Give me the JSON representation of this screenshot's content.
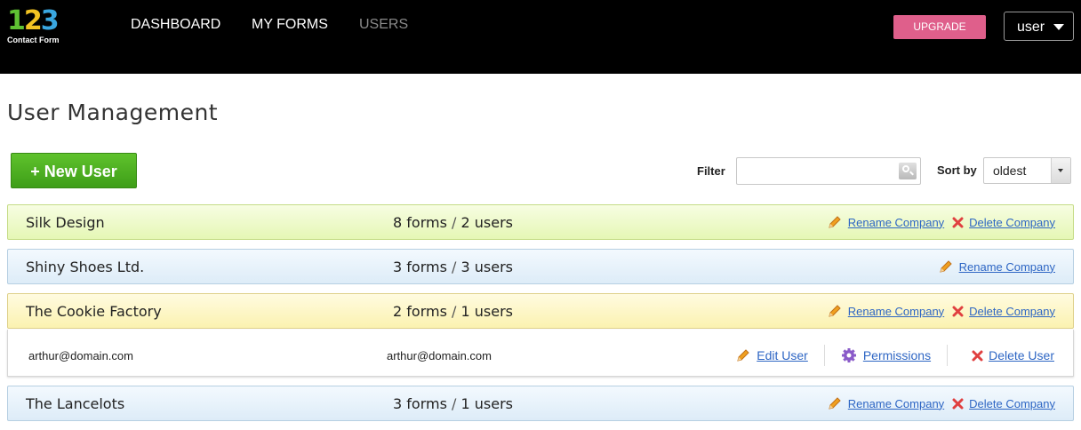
{
  "header": {
    "logo_digits": [
      "1",
      "2",
      "3"
    ],
    "logo_text": "Contact Form",
    "nav": [
      "DASHBOARD",
      "MY FORMS",
      "USERS"
    ],
    "upgrade_label": "UPGRADE",
    "user_menu_label": "user"
  },
  "page": {
    "title": "User Management",
    "new_user_label": "+ New User",
    "filter_label": "Filter",
    "filter_value": "",
    "sort_label": "Sort by",
    "sort_value": "oldest"
  },
  "companies": [
    {
      "name": "Silk Design",
      "forms": "8 forms",
      "users": "2 users",
      "rename_label": "Rename Company",
      "delete_label": "Delete Company"
    },
    {
      "name": "Shiny Shoes Ltd.",
      "forms": "3 forms",
      "users": "3 users",
      "rename_label": "Rename Company"
    },
    {
      "name": "The Cookie Factory",
      "forms": "2 forms",
      "users": "1 users",
      "rename_label": "Rename Company",
      "delete_label": "Delete Company"
    },
    {
      "name": "The Lancelots",
      "forms": "3 forms",
      "users": "1 users",
      "rename_label": "Rename Company",
      "delete_label": "Delete Company"
    }
  ],
  "count_separator": "/",
  "expanded_user": {
    "email": "arthur@domain.com",
    "login": "arthur@domain.com",
    "edit_label": "Edit User",
    "permissions_label": "Permissions",
    "delete_label": "Delete User"
  },
  "colors": {
    "topbar": "#000000",
    "upgrade": "#df5f8b",
    "new_user": "#4fb022",
    "link": "#2e66c4"
  }
}
